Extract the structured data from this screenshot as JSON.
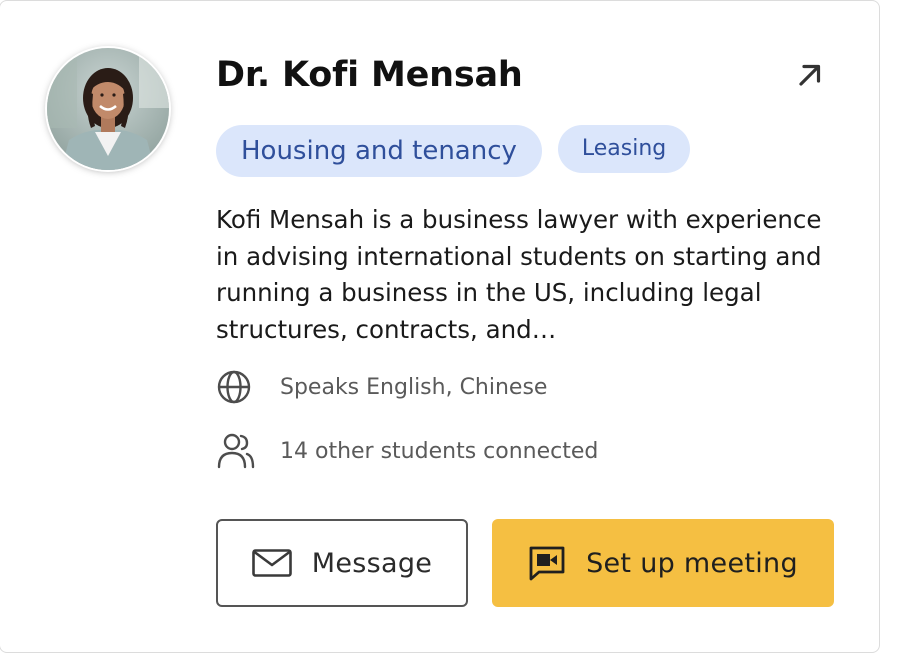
{
  "profile": {
    "name": "Dr. Kofi Mensah",
    "tags": [
      "Housing and tenancy",
      "Leasing"
    ],
    "bio": "Kofi Mensah is a business lawyer with experience in advising international students on starting and running a business in the US, including legal structures, contracts, and…",
    "languages": "Speaks English, Chinese",
    "connections": "14 other students connected"
  },
  "actions": {
    "message_label": "Message",
    "meeting_label": "Set up meeting"
  },
  "icons": {
    "open": "arrow-up-right-icon",
    "languages": "globe-icon",
    "connections": "users-icon",
    "message": "envelope-icon",
    "meeting": "video-chat-icon"
  },
  "colors": {
    "tag_bg": "#dbe6fb",
    "tag_text": "#2f4f9b",
    "primary_button": "#f5bf42",
    "secondary_border": "#555555"
  }
}
